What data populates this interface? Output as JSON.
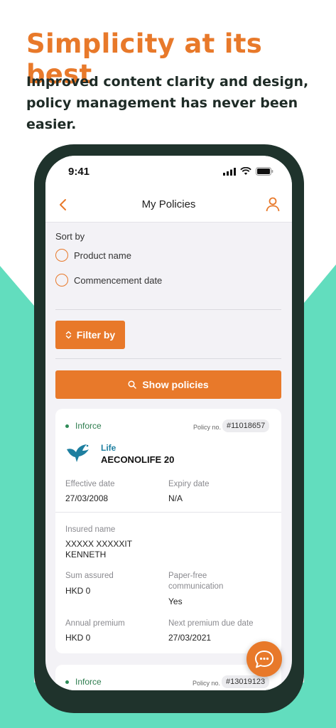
{
  "headline": "Simplicity at its best",
  "subheadline": "Improved content clarity and design, policy management has never been easier.",
  "colors": {
    "accent": "#E8792A",
    "teal": "#62DDBE",
    "phone_frame": "#1F332C",
    "inforce": "#2E8B57"
  },
  "status_bar": {
    "time": "9:41"
  },
  "nav": {
    "title": "My Policies",
    "back_icon": "chevron-left-icon",
    "profile_icon": "user-icon"
  },
  "sort": {
    "label": "Sort by",
    "options": [
      "Product name",
      "Commencement date"
    ]
  },
  "filter_button": "Filter by",
  "show_button": "Show policies",
  "policies": [
    {
      "status": "Inforce",
      "policy_no_label": "Policy no.",
      "policy_no": "#11018657",
      "category": "Life",
      "product": "AECONOLIFE 20",
      "effective_date_label": "Effective date",
      "effective_date": "27/03/2008",
      "expiry_date_label": "Expiry date",
      "expiry_date": "N/A",
      "insured_name_label": "Insured name",
      "insured_name_line1": "XXXXX XXXXXIT",
      "insured_name_line2": "KENNETH",
      "sum_assured_label": "Sum assured",
      "sum_assured": "HKD 0",
      "paper_free_label_line1": "Paper-free",
      "paper_free_label_line2": "communication",
      "paper_free": "Yes",
      "annual_premium_label": "Annual premium",
      "annual_premium": "HKD 0",
      "next_due_label": "Next premium due date",
      "next_due": "27/03/2021"
    },
    {
      "status": "Inforce",
      "policy_no_label": "Policy no.",
      "policy_no": "#13019123"
    }
  ],
  "chat_icon": "chat-bubble-icon"
}
